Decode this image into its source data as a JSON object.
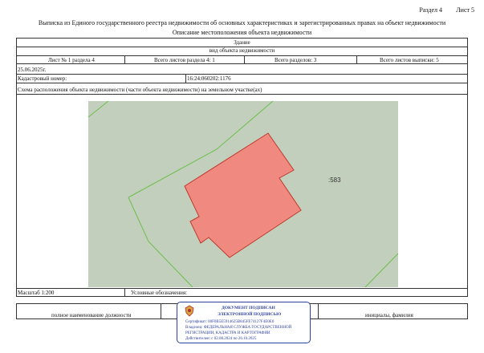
{
  "header": {
    "section": "Раздел 4",
    "sheet": "Лист 5",
    "title": "Выписка из Единого государственного реестра недвижимости об основных характеристиках и зарегистрированных правах на объект недвижимости",
    "subtitle": "Описание местоположения объекта недвижимости"
  },
  "object": {
    "type": "Здание",
    "type_caption": "вид объекта недвижимости"
  },
  "sheets_row": {
    "sheet_info": "Лист № 1 раздела 4",
    "total_in_section": "Всего листов раздела 4: 1",
    "total_sections": "Всего разделов: 3",
    "total_sheets": "Всего листов выписки: 5"
  },
  "date": "25.06.2025г.",
  "cadastral": {
    "label": "Кадастровый номер:",
    "value": "16:24:060202:1176"
  },
  "scheme_title": "Схема расположения объекта недвижимости (части объекта недвижимости) на земельном участке(ах)",
  "map": {
    "parcel_label": ":583",
    "background": "#c3cfbd",
    "building_fill": "#f08a80",
    "building_stroke": "#c0392b",
    "boundary_color": "#6bbf4a"
  },
  "scale": {
    "label": "Масштаб 1:200",
    "legend_label": "Условные обозначения:"
  },
  "signature": {
    "position_caption": "полное наименование должности",
    "name_caption": "инициалы, фамилия"
  },
  "stamp": {
    "line1": "ДОКУМЕНТ ПОДПИСАН",
    "line2": "ЭЛЕКТРОННОЙ ПОДПИСЬЮ",
    "cert": "Сертификат: 00F0B5E5914625B845FE74127F4E0E0",
    "owner1": "Владелец: ФЕДЕРАЛЬНАЯ СЛУЖБА ГОСУДАРСТВЕННОЙ",
    "owner2": "РЕГИСТРАЦИИ, КАДАСТРА И КАРТОГРАФИИ",
    "valid": "Действителен: с 02.08.2024 по 26.10.2025",
    "color": "#2c3f9b"
  }
}
